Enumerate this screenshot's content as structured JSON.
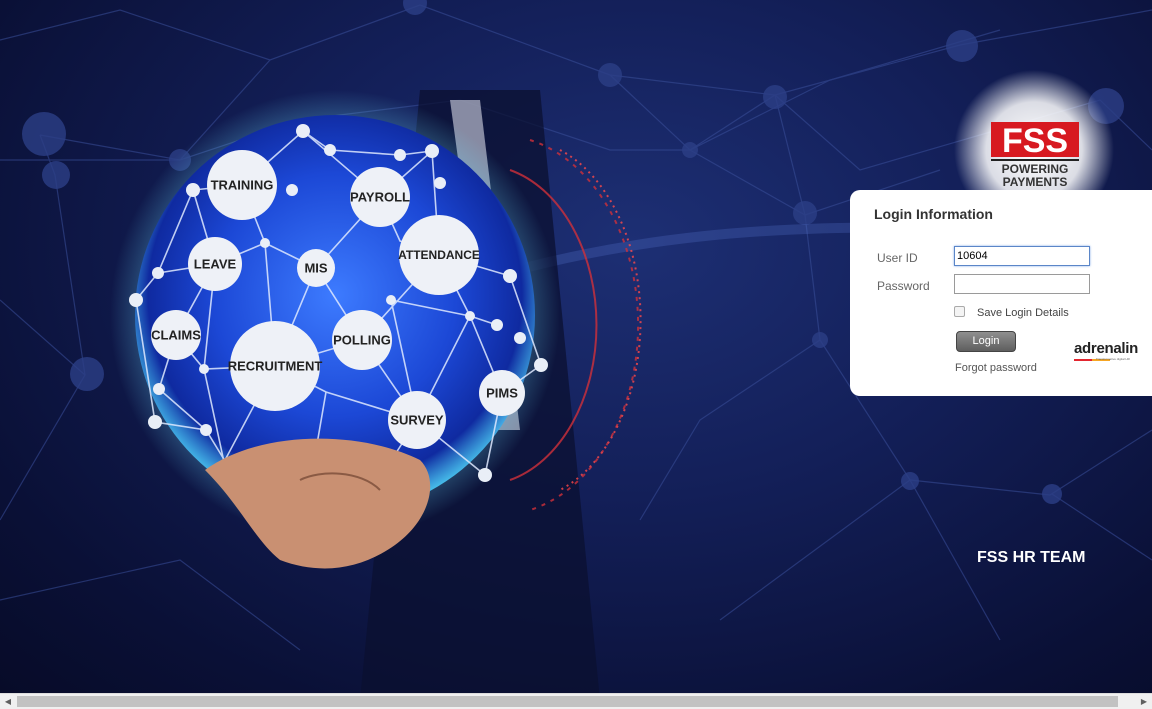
{
  "brand": {
    "logo_main": "FSS",
    "logo_tagline_1": "POWERING",
    "logo_tagline_2": "PAYMENTS",
    "accent_color": "#d71920"
  },
  "globe": {
    "modules": [
      "TRAINING",
      "PAYROLL",
      "LEAVE",
      "MIS",
      "ATTENDANCE",
      "CLAIMS",
      "RECRUITMENT",
      "POLLING",
      "PIMS",
      "SURVEY"
    ]
  },
  "login": {
    "title": "Login Information",
    "user_id_label": "User ID",
    "user_id_value": "10604",
    "password_label": "Password",
    "password_value": "",
    "save_label": "Save Login Details",
    "save_checked": false,
    "login_button": "Login",
    "forgot_link": "Forgot password"
  },
  "partner_logo": {
    "name": "adrenalin",
    "tagline": "Transformative digital HR"
  },
  "footer": {
    "team": "FSS HR TEAM"
  },
  "scrollbar": {
    "left_arrow": "◀",
    "right_arrow": "▶"
  }
}
